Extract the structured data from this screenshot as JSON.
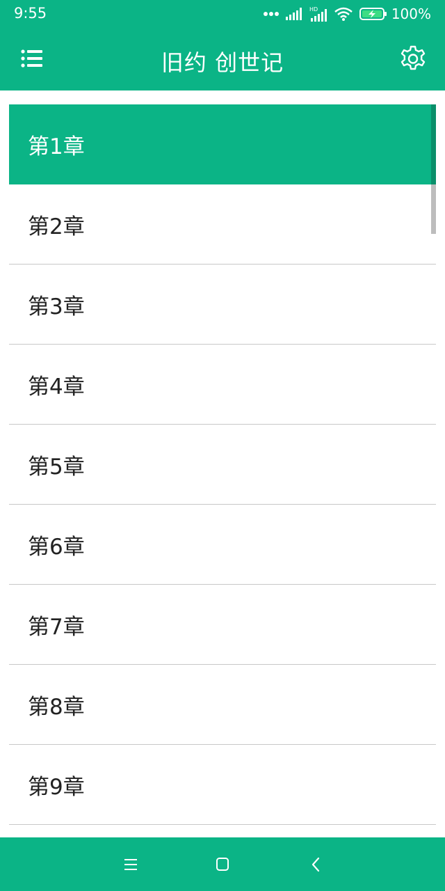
{
  "status_bar": {
    "time": "9:55",
    "battery": "100%",
    "icons": [
      "more-dots-icon",
      "signal-icon",
      "hd-signal-icon",
      "wifi-icon",
      "battery-charging-icon"
    ]
  },
  "app_bar": {
    "title": "旧约 创世记",
    "menu_icon": "list-menu-icon",
    "settings_icon": "gear-icon"
  },
  "chapters": [
    "第1章",
    "第2章",
    "第3章",
    "第4章",
    "第5章",
    "第6章",
    "第7章",
    "第8章",
    "第9章"
  ],
  "selected_chapter": "第1章",
  "nav_bar": {
    "icons": [
      "menu-lines-icon",
      "home-square-icon",
      "back-chevron-icon"
    ]
  },
  "colors": {
    "primary": "#0bb486",
    "text": "#222222",
    "divider": "#c8c8c8"
  }
}
